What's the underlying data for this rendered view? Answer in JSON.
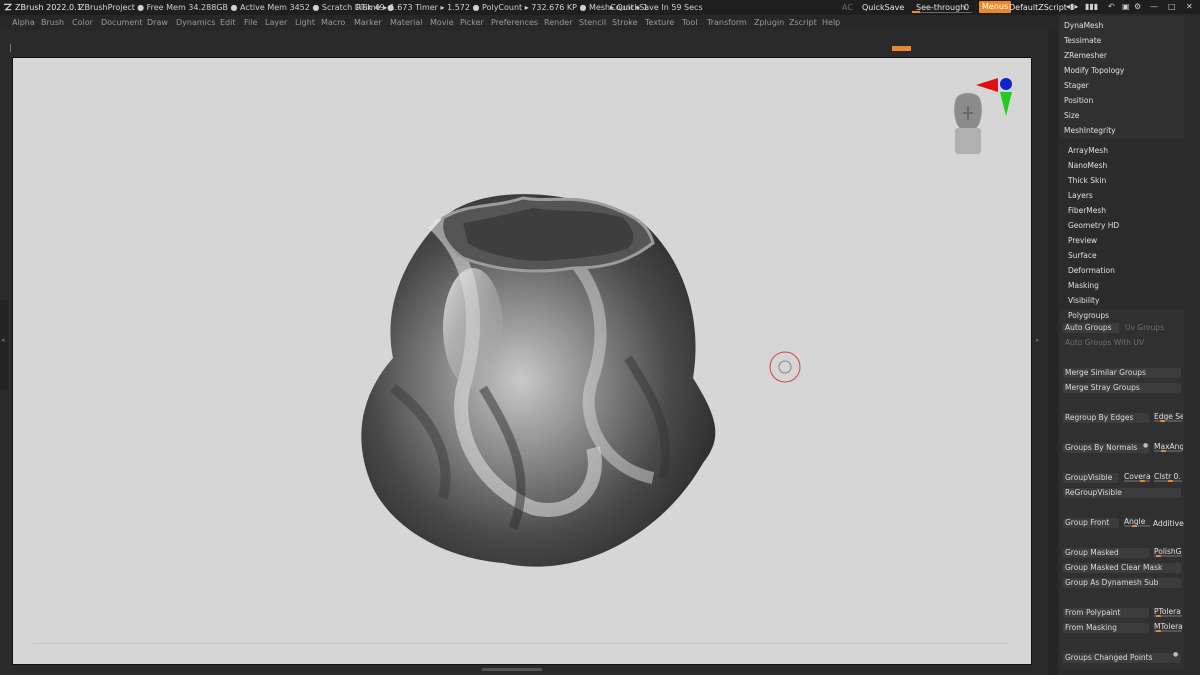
{
  "titlebar": {
    "app": "ZBrush 2022.0.1",
    "project": "ZBrushProject",
    "stats": ". ● Free Mem 34.288GB ● Active Mem 3452 ● Scratch Disk 49 ●",
    "rtime": "RTime ▸ 1.673 Timer ▸ 1.572 ● PolyCount ▸ 732.676 KP ● MeshCount ▸ 1",
    "quicksave_timer": "▸ QuickSave In 59 Secs",
    "ac": "AC",
    "quicksave": "QuickSave",
    "see_through_label": "See-through",
    "see_through_value": "0",
    "menus": "Menus",
    "script": "DefaultZScript"
  },
  "menubar": [
    "Alpha",
    "Brush",
    "Color",
    "Document",
    "Draw",
    "Dynamics",
    "Edit",
    "File",
    "Layer",
    "Light",
    "Macro",
    "Marker",
    "Material",
    "Movie",
    "Picker",
    "Preferences",
    "Render",
    "Stencil",
    "Stroke",
    "Texture",
    "Tool",
    "Transform",
    "Zplugin",
    "Zscript",
    "Help"
  ],
  "geometry_items": [
    "DynaMesh",
    "Tessimate",
    "ZRemesher",
    "Modify Topology",
    "Stager",
    "Position",
    "Size",
    "MeshIntegrity"
  ],
  "subpalettes": [
    "ArrayMesh",
    "NanoMesh",
    "Thick Skin",
    "Layers",
    "FiberMesh",
    "Geometry HD",
    "Preview",
    "Surface",
    "Deformation",
    "Masking",
    "Visibility"
  ],
  "polygroups": {
    "title": "Polygroups",
    "auto_groups": "Auto Groups",
    "uv_groups": "Uv Groups",
    "auto_groups_uv": "Auto Groups With UV",
    "merge_similar": "Merge Similar Groups",
    "merge_stray": "Merge Stray Groups",
    "regroup_edges": "Regroup By Edges",
    "edge_se": "Edge Se",
    "groups_normals": "Groups By Normals",
    "maxang": "MaxAng",
    "group_visible": "GroupVisible",
    "coverage": "Coverag",
    "clstr": "Clstr 0.",
    "regroup_visible": "ReGroupVisible",
    "group_front": "Group Front",
    "angle": "Angle",
    "additive": "Additive",
    "group_masked": "Group Masked",
    "polishg": "PolishG",
    "group_masked_clear": "Group Masked Clear Mask",
    "group_as_dynamesh": "Group As Dynamesh Sub",
    "from_polypaint": "From Polypaint",
    "ptolera": "PTolera",
    "from_masking": "From Masking",
    "mtolera": "MTolera",
    "groups_changed_points": "Groups Changed Points"
  },
  "colors": {
    "accent": "#e98a2a",
    "viewport_bg": "#d6d6d6",
    "panel_bg": "#2b2b2b"
  }
}
